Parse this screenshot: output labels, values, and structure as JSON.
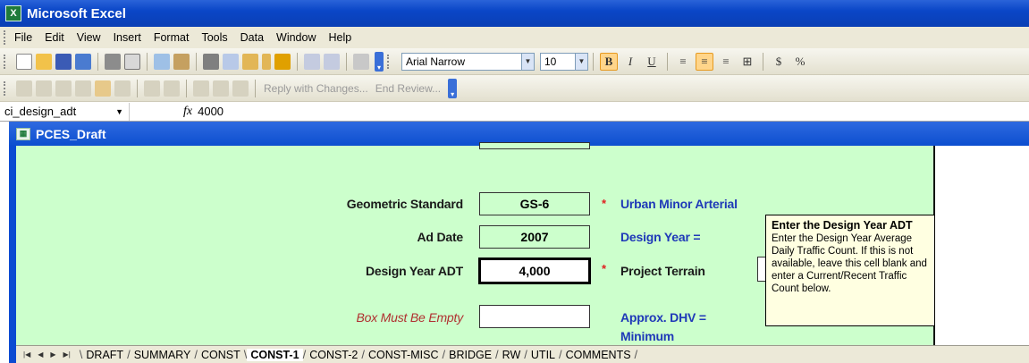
{
  "app": {
    "title": "Microsoft Excel",
    "icon": "excel-icon"
  },
  "menu": [
    "File",
    "Edit",
    "View",
    "Insert",
    "Format",
    "Tools",
    "Data",
    "Window",
    "Help"
  ],
  "toolbar": {
    "font_name": "Arial Narrow",
    "font_size": "10",
    "bold": "B",
    "italic": "I",
    "underline": "U",
    "currency": "$",
    "percent": "%"
  },
  "review_toolbar": {
    "reply_label": "Reply with Changes...",
    "end_review_label": "End Review..."
  },
  "formula_bar": {
    "name_box": "ci_design_adt",
    "fx": "fx",
    "value": "4000"
  },
  "workbook": {
    "title": "PCES_Draft"
  },
  "form": {
    "geometric_standard_label": "Geometric Standard",
    "geometric_standard_value": "GS-6",
    "ad_date_label": "Ad Date",
    "ad_date_value": "2007",
    "design_year_adt_label": "Design Year ADT",
    "design_year_adt_value": "4,000",
    "box_empty_label": "Box Must Be Empty",
    "urban_label": "Urban Minor Arterial",
    "design_year_label": "Design Year =",
    "project_terrain_label": "Project Terrain",
    "approx_dhv_label": "Approx. DHV =",
    "minimum_label": "Minimum",
    "star": "*"
  },
  "comment": {
    "title": "Enter the Design Year ADT",
    "body": "Enter the Design Year Average Daily Traffic Count.  If this is not available, leave this cell blank and enter a Current/Recent Traffic Count below."
  },
  "sheet_tabs": [
    "DRAFT",
    "SUMMARY",
    "CONST",
    "CONST-1",
    "CONST-2",
    "CONST-MISC",
    "BRIDGE",
    "RW",
    "UTIL",
    "COMMENTS"
  ],
  "active_tab": "CONST-1",
  "colors": {
    "title_bar": "#0a46c7",
    "form_bg": "#ccffcc",
    "comment_bg": "#ffffe1",
    "label_blue": "#1f39b8",
    "label_red": "#b03030"
  }
}
